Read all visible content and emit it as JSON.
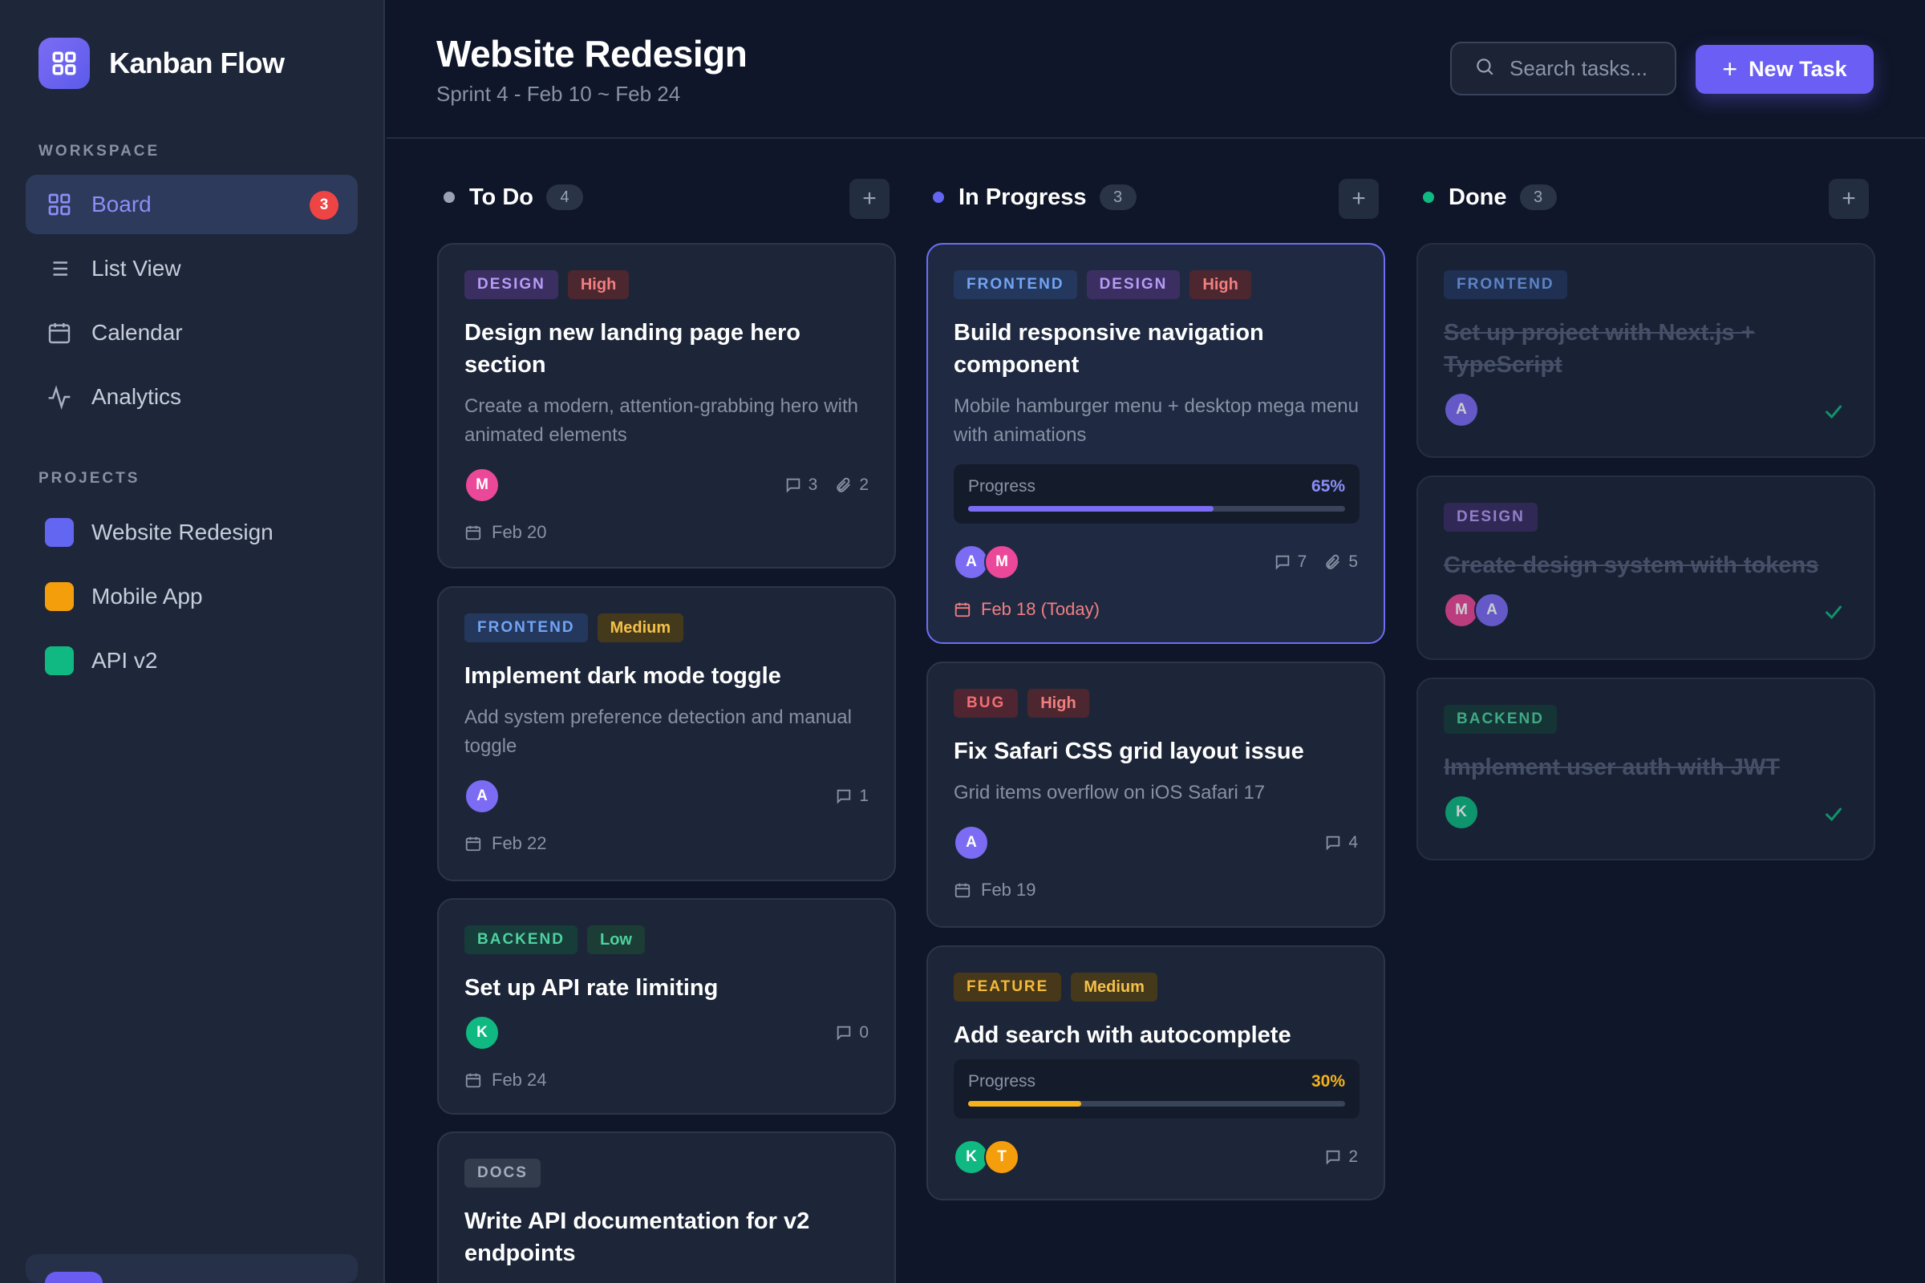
{
  "app": {
    "name": "Kanban Flow"
  },
  "sidebar": {
    "workspace_label": "WORKSPACE",
    "nav": [
      {
        "label": "Board",
        "icon": "grid-icon",
        "badge": "3",
        "active": true
      },
      {
        "label": "List View",
        "icon": "list-icon"
      },
      {
        "label": "Calendar",
        "icon": "calendar-icon"
      },
      {
        "label": "Analytics",
        "icon": "activity-icon"
      }
    ],
    "projects_label": "PROJECTS",
    "projects": [
      {
        "label": "Website Redesign",
        "color": "#6366f1"
      },
      {
        "label": "Mobile App",
        "color": "#f59e0b"
      },
      {
        "label": "API v2",
        "color": "#10b981"
      }
    ]
  },
  "header": {
    "title": "Website Redesign",
    "subtitle": "Sprint 4 - Feb 10 ~ Feb 24",
    "search_placeholder": "Search tasks...",
    "new_task_label": "New Task"
  },
  "columns": [
    {
      "title": "To Do",
      "count": "4",
      "dot_color": "#9aa3b5",
      "cards": [
        {
          "tags": [
            "DESIGN"
          ],
          "priority": "High",
          "title": "Design new landing page hero section",
          "desc": "Create a modern, attention-grabbing hero with animated elements",
          "avatars": [
            "M"
          ],
          "comments": "3",
          "attachments": "2",
          "due": "Feb 20"
        },
        {
          "tags": [
            "FRONTEND"
          ],
          "priority": "Medium",
          "title": "Implement dark mode toggle",
          "desc": "Add system preference detection and manual toggle",
          "avatars": [
            "A"
          ],
          "comments": "1",
          "due": "Feb 22"
        },
        {
          "tags": [
            "BACKEND"
          ],
          "priority": "Low",
          "title": "Set up API rate limiting",
          "avatars": [
            "K"
          ],
          "comments": "0",
          "due": "Feb 24"
        },
        {
          "tags": [
            "DOCS"
          ],
          "title": "Write API documentation for v2 endpoints"
        }
      ]
    },
    {
      "title": "In Progress",
      "count": "3",
      "dot_color": "#6366f1",
      "cards": [
        {
          "tags": [
            "FRONTEND",
            "DESIGN"
          ],
          "priority": "High",
          "title": "Build responsive navigation component",
          "desc": "Mobile hamburger menu + desktop mega menu with animations",
          "progress_label": "Progress",
          "progress": "65%",
          "avatars": [
            "A",
            "M"
          ],
          "comments": "7",
          "attachments": "5",
          "due": "Feb 18 (Today)"
        },
        {
          "tags": [
            "BUG"
          ],
          "priority": "High",
          "title": "Fix Safari CSS grid layout issue",
          "desc": "Grid items overflow on iOS Safari 17",
          "avatars": [
            "A"
          ],
          "comments": "4",
          "due": "Feb 19"
        },
        {
          "tags": [
            "FEATURE"
          ],
          "priority": "Medium",
          "title": "Add search with autocomplete",
          "progress_label": "Progress",
          "progress": "30%",
          "avatars": [
            "K",
            "T"
          ],
          "comments": "2"
        }
      ]
    },
    {
      "title": "Done",
      "count": "3",
      "dot_color": "#10b981",
      "cards": [
        {
          "tags": [
            "FRONTEND"
          ],
          "title": "Set up project with Next.js + TypeScript",
          "avatars": [
            "A"
          ]
        },
        {
          "tags": [
            "DESIGN"
          ],
          "title": "Create design system with tokens",
          "avatars": [
            "M",
            "A"
          ]
        },
        {
          "tags": [
            "BACKEND"
          ],
          "title": "Implement user auth with JWT",
          "avatars": [
            "K"
          ]
        }
      ]
    }
  ],
  "colors": {
    "accent": "#6a5ef4",
    "avatar_M": "#ec4899",
    "avatar_A": "#7c6cf4",
    "avatar_K": "#10b981",
    "avatar_T": "#f59e0b",
    "progress_high": "#7c6cf4",
    "progress_low": "#f5b21b"
  }
}
